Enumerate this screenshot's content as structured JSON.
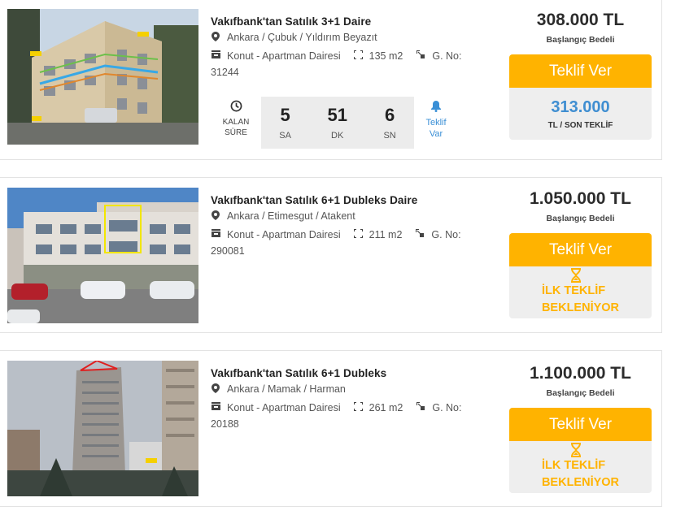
{
  "listings": [
    {
      "title": "Vakıfbank'tan Satılık 3+1 Daire",
      "location": "Ankara / Çubuk / Yıldırım Beyazıt",
      "type": "Konut - Apartman Dairesi",
      "area": "135 m2",
      "gno_label": "G. No:",
      "gno": "31244",
      "timer": {
        "kalan_line1": "KALAN",
        "kalan_line2": "SÜRE",
        "hours": "5",
        "hours_label": "SA",
        "minutes": "51",
        "minutes_label": "DK",
        "seconds": "6",
        "seconds_label": "SN",
        "alert_line1": "Teklif",
        "alert_line2": "Var"
      },
      "price": "308.000 TL",
      "price_label": "Başlangıç Bedeli",
      "button": "Teklif Ver",
      "last_offer": "313.000",
      "last_offer_label": "TL / SON TEKLİF"
    },
    {
      "title": "Vakıfbank'tan Satılık 6+1 Dubleks Daire",
      "location": "Ankara / Etimesgut / Atakent",
      "type": "Konut - Apartman Dairesi",
      "area": "211 m2",
      "gno_label": "G. No:",
      "gno": "290081",
      "price": "1.050.000 TL",
      "price_label": "Başlangıç Bedeli",
      "button": "Teklif Ver",
      "waiting_line1": "İLK TEKLİF",
      "waiting_line2": "BEKLENİYOR"
    },
    {
      "title": "Vakıfbank'tan Satılık 6+1 Dubleks",
      "location": "Ankara / Mamak / Harman",
      "type": "Konut - Apartman Dairesi",
      "area": "261 m2",
      "gno_label": "G. No:",
      "gno": "20188",
      "price": "1.100.000 TL",
      "price_label": "Başlangıç Bedeli",
      "button": "Teklif Ver",
      "waiting_line1": "İLK TEKLİF",
      "waiting_line2": "BEKLENİYOR"
    }
  ],
  "colors": {
    "accent": "#ffb300",
    "link": "#3f8ed1",
    "panel": "#eeeeee"
  }
}
